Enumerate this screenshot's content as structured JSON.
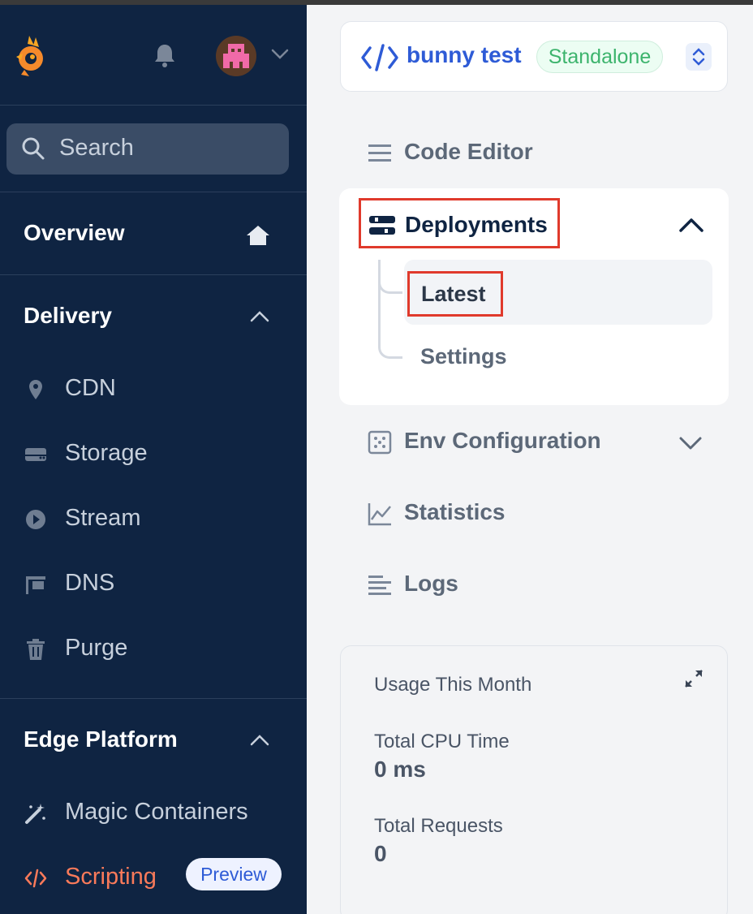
{
  "sidebar": {
    "logo": "bunny-logo",
    "search": {
      "label": "Search"
    },
    "overview": {
      "label": "Overview"
    },
    "delivery": {
      "label": "Delivery",
      "items": [
        {
          "label": "CDN",
          "icon": "location-pin-icon"
        },
        {
          "label": "Storage",
          "icon": "storage-drive-icon"
        },
        {
          "label": "Stream",
          "icon": "play-circle-icon"
        },
        {
          "label": "DNS",
          "icon": "dns-sign-icon"
        },
        {
          "label": "Purge",
          "icon": "trash-icon"
        }
      ]
    },
    "edge": {
      "label": "Edge Platform",
      "items": [
        {
          "label": "Magic Containers",
          "icon": "magic-wand-icon"
        },
        {
          "label": "Scripting",
          "icon": "code-icon",
          "badge": "Preview",
          "active": true
        }
      ]
    }
  },
  "project": {
    "name": "bunny test",
    "badge": "Standalone"
  },
  "menu": {
    "code_editor": "Code Editor",
    "deployments": "Deployments",
    "latest": "Latest",
    "settings": "Settings",
    "env_configuration": "Env Configuration",
    "statistics": "Statistics",
    "logs": "Logs"
  },
  "usage": {
    "title": "Usage This Month",
    "cpu_label": "Total CPU Time",
    "cpu_value": "0 ms",
    "requests_label": "Total Requests",
    "requests_value": "0"
  },
  "colors": {
    "sidebar_bg": "#0f2442",
    "accent_blue": "#2e5bd6",
    "active_orange": "#f97a5a",
    "highlight_red": "#e03a2c",
    "badge_green": "#3db46d"
  }
}
